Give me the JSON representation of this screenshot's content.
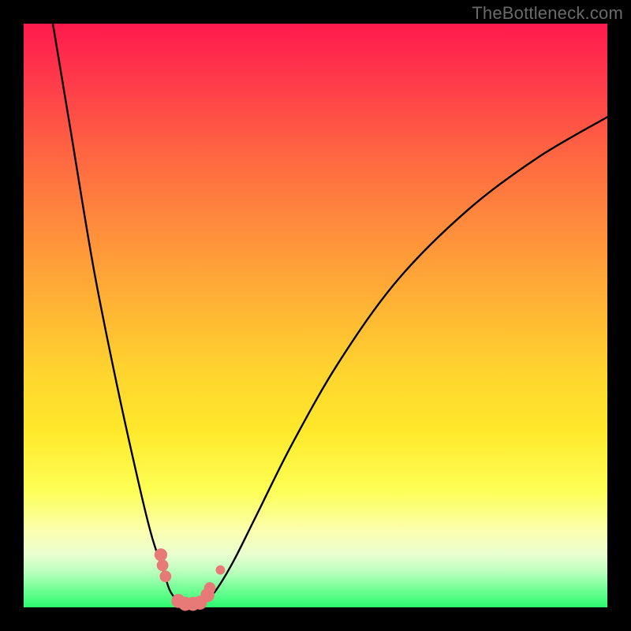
{
  "watermark": "TheBottleneck.com",
  "colors": {
    "background_black": "#000000",
    "gradient_top": "#ff1a4d",
    "gradient_mid": "#ffd52e",
    "gradient_bottom": "#2bfa6e",
    "curve_stroke": "#000000",
    "marker_fill": "#e77a76",
    "watermark_text": "#6a6a6a"
  },
  "chart_data": {
    "type": "line",
    "title": "",
    "xlabel": "",
    "ylabel": "",
    "xlim": [
      0,
      100
    ],
    "ylim": [
      0,
      100
    ],
    "grid": false,
    "legend": false,
    "series": [
      {
        "name": "left-curve",
        "x": [
          5,
          8,
          12,
          16,
          20,
          22,
          24,
          25,
          26,
          27,
          28
        ],
        "y": [
          100,
          82,
          58,
          38,
          20,
          12,
          6,
          3,
          1.5,
          0.8,
          0
        ]
      },
      {
        "name": "right-curve",
        "x": [
          30,
          31,
          33,
          36,
          40,
          46,
          54,
          64,
          76,
          88,
          100
        ],
        "y": [
          0,
          0.8,
          3,
          8,
          16,
          28,
          42,
          56,
          68,
          77,
          84
        ]
      }
    ],
    "markers": [
      {
        "x": 23.5,
        "y": 9.0,
        "r": 1.1
      },
      {
        "x": 23.8,
        "y": 7.2,
        "r": 1.0
      },
      {
        "x": 24.3,
        "y": 5.3,
        "r": 1.0
      },
      {
        "x": 26.5,
        "y": 1.1,
        "r": 1.2
      },
      {
        "x": 27.7,
        "y": 0.6,
        "r": 1.2
      },
      {
        "x": 29.0,
        "y": 0.6,
        "r": 1.2
      },
      {
        "x": 30.2,
        "y": 0.8,
        "r": 1.2
      },
      {
        "x": 31.5,
        "y": 2.1,
        "r": 1.2
      },
      {
        "x": 31.9,
        "y": 3.3,
        "r": 1.0
      },
      {
        "x": 33.7,
        "y": 6.4,
        "r": 0.8
      }
    ]
  }
}
